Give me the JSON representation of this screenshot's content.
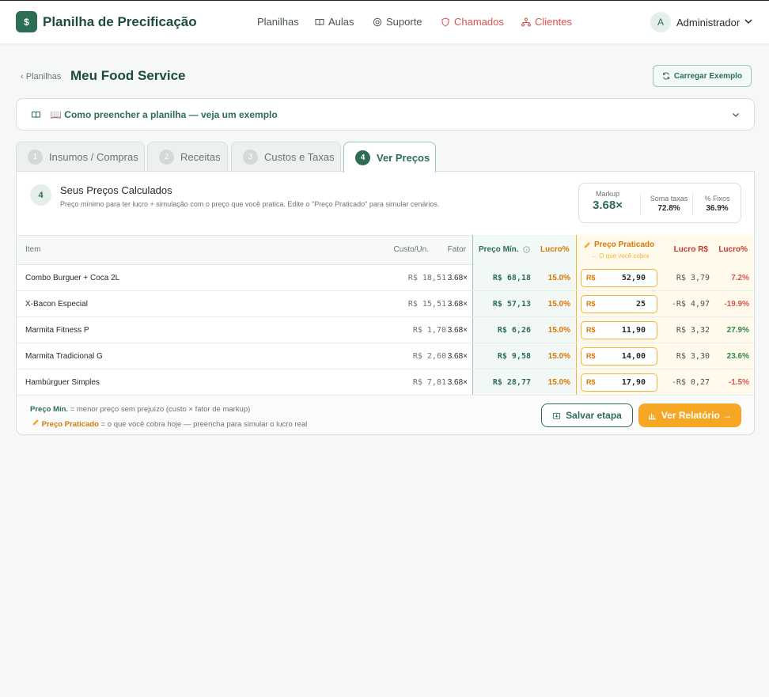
{
  "header": {
    "logo_glyph": "$",
    "app_title": "Planilha de Precificação",
    "nav": [
      {
        "label": "Planilhas",
        "icon": ""
      },
      {
        "label": "Aulas",
        "icon": "book-icon"
      },
      {
        "label": "Suporte",
        "icon": "lifebuoy-icon"
      },
      {
        "label": "Chamados",
        "icon": "shield-icon"
      },
      {
        "label": "Clientes",
        "icon": "network-icon"
      }
    ],
    "user_initial": "A",
    "user_name": "Administrador"
  },
  "breadcrumb": {
    "back_label": "Planilhas",
    "title": "Meu Food Service"
  },
  "load_example_label": "Carregar Exemplo",
  "accordion": {
    "label": "📖 Como preencher a planilha — veja um exemplo"
  },
  "tabs": [
    {
      "num": "1",
      "label": "Insumos / Compras"
    },
    {
      "num": "2",
      "label": "Receitas"
    },
    {
      "num": "3",
      "label": "Custos e Taxas"
    },
    {
      "num": "4",
      "label": "Ver Preços"
    }
  ],
  "section": {
    "step": "4",
    "title": "Seus Preços Calculados",
    "subtitle": "Preço mínimo para ter lucro + simulação com o preço que você pratica. Edite o \"Preço Praticado\" para simular cenários."
  },
  "stats": {
    "markup_label": "Markup",
    "markup_value": "3.68×",
    "taxes_label": "Soma taxas",
    "taxes_value": "72.8%",
    "fixed_label": "% Fixos",
    "fixed_value": "36.9%"
  },
  "table": {
    "headers": {
      "item": "Item",
      "cost": "Custo/Un.",
      "factor": "Fator",
      "min_price": "Preço Mín.",
      "margin": "Lucro%",
      "practiced": "Preço Praticado",
      "practiced_hint": "← O que você cobra",
      "profit_rs": "Lucro R$",
      "profit_pct": "Lucro%"
    },
    "currency": "R$",
    "rows": [
      {
        "item": "Combo Burguer + Coca 2L",
        "cost": "R$ 18,51",
        "factor": "3.68×",
        "min_price": "R$ 68,18",
        "margin": "15.0%",
        "practiced": "52,90",
        "profit_rs": "R$ 3,79",
        "profit_pct": "7.2%",
        "sign": "neg"
      },
      {
        "item": "X-Bacon Especial",
        "cost": "R$ 15,51",
        "factor": "3.68×",
        "min_price": "R$ 57,13",
        "margin": "15.0%",
        "practiced": "25",
        "profit_rs": "-R$ 4,97",
        "profit_pct": "-19.9%",
        "sign": "neg"
      },
      {
        "item": "Marmita Fitness P",
        "cost": "R$ 1,70",
        "factor": "3.68×",
        "min_price": "R$ 6,26",
        "margin": "15.0%",
        "practiced": "11,90",
        "profit_rs": "R$ 3,32",
        "profit_pct": "27.9%",
        "sign": "pos"
      },
      {
        "item": "Marmita Tradicional G",
        "cost": "R$ 2,60",
        "factor": "3.68×",
        "min_price": "R$ 9,58",
        "margin": "15.0%",
        "practiced": "14,00",
        "profit_rs": "R$ 3,30",
        "profit_pct": "23.6%",
        "sign": "pos"
      },
      {
        "item": "Hambúrguer Simples",
        "cost": "R$ 7,81",
        "factor": "3.68×",
        "min_price": "R$ 28,77",
        "margin": "15.0%",
        "practiced": "17,90",
        "profit_rs": "-R$ 0,27",
        "profit_pct": "-1.5%",
        "sign": "neg"
      }
    ]
  },
  "legend": {
    "min_label": "Preço Mín.",
    "min_text": "= menor preço sem prejuízo (custo × fator de markup)",
    "practiced_label": "Preço Praticado",
    "practiced_text": "= o que você cobra hoje — preencha para simular o lucro real"
  },
  "buttons": {
    "save": "Salvar etapa",
    "report": "Ver Relatório →"
  },
  "colors": {
    "brand": "#2c6e53",
    "accent": "#f5a623",
    "danger": "#d9534f",
    "success": "#2c8a4b"
  }
}
